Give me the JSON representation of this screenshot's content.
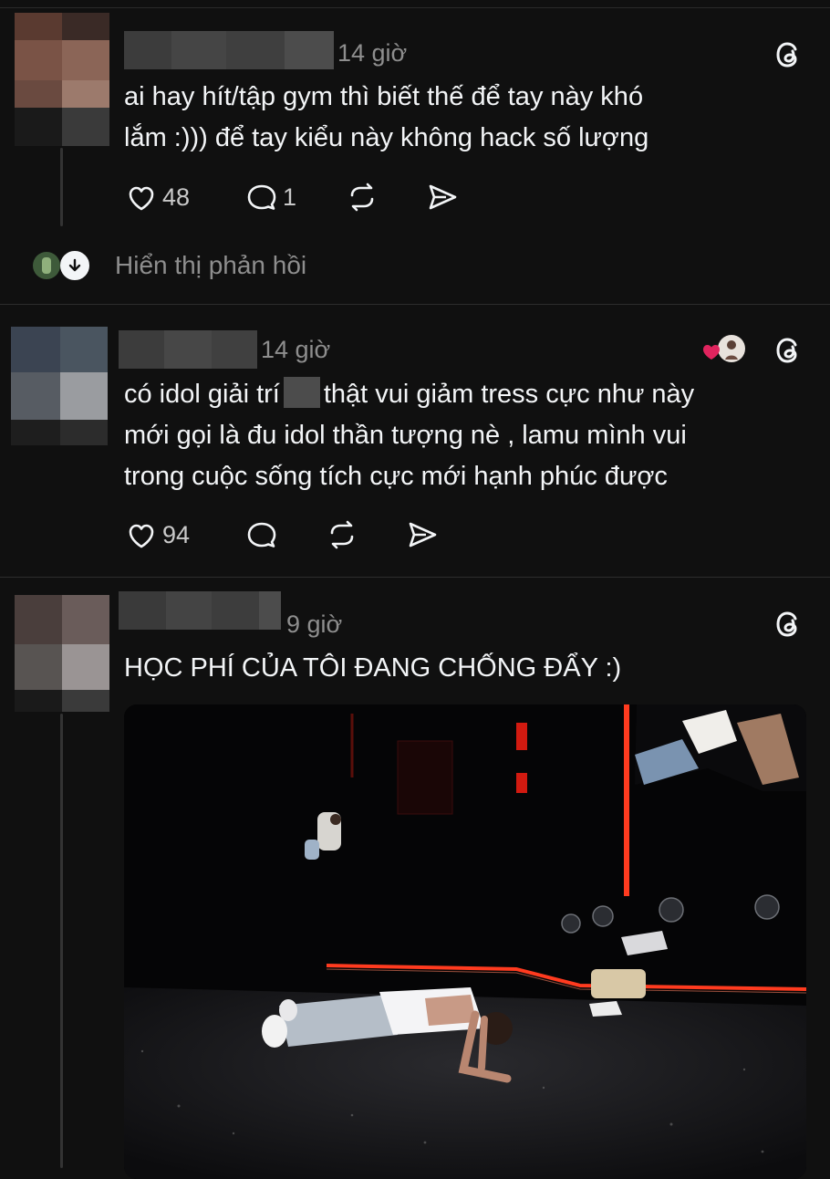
{
  "posts": [
    {
      "time": "14 giờ",
      "lines": [
        "ai hay hít/tập gym thì biết thế để tay này khó",
        "lắm :))) để tay kiểu này không hack số lượng"
      ],
      "likes": "48",
      "comments": "1",
      "replies_label": "Hiển thị phản hồi"
    },
    {
      "time": "14 giờ",
      "line1_a": "có idol giải trí",
      "line1_b": "thật vui  giảm tress cực như này",
      "line2": "mới gọi là đu idol thần tượng nè , lamu mình vui",
      "line3": "trong cuộc sống tích cực mới  hạnh phúc được",
      "likes": "94"
    },
    {
      "time": "9 giờ",
      "text": "HỌC PHÍ CỦA TÔI ĐANG CHỐNG ĐẨY :)"
    }
  ],
  "icons": [
    "threads-icon",
    "heart-icon",
    "comment-icon",
    "repost-icon",
    "share-icon",
    "arrow-down-icon"
  ],
  "colors": {
    "background": "#101010",
    "text": "#f3f5f7",
    "muted": "#8e8e8e",
    "liked_heart": "#e0245e",
    "stage_red": "#ff3b1f"
  }
}
